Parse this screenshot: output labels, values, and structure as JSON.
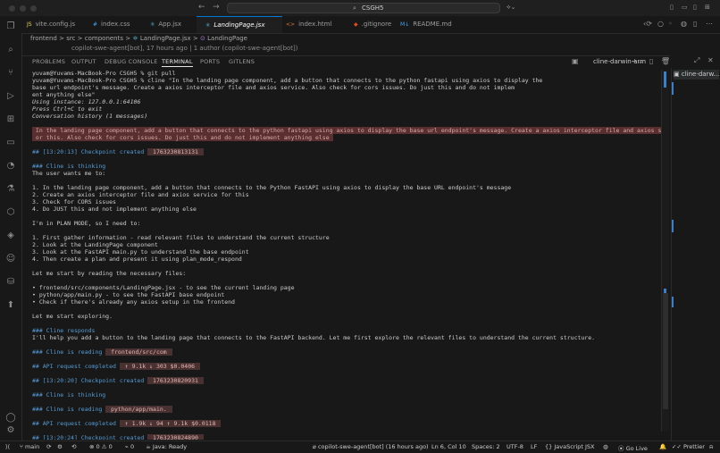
{
  "window": {
    "search_text": "CSGH5"
  },
  "tabs": [
    {
      "label": "vite.config.js",
      "icon": "JS"
    },
    {
      "label": "index.css",
      "icon": "#"
    },
    {
      "label": "App.jsx",
      "icon": "⚛"
    },
    {
      "label": "LandingPage.jsx",
      "icon": "⚛"
    },
    {
      "label": "index.html",
      "icon": "<>"
    },
    {
      "label": ".gitignore",
      "icon": "◆"
    },
    {
      "label": "README.md",
      "icon": "M↓"
    }
  ],
  "breadcrumb": {
    "parts": [
      "frontend",
      "src",
      "components",
      "LandingPage.jsx",
      "LandingPage"
    ],
    "sep": ">"
  },
  "blame": "copilot-swe-agent[bot], 17 hours ago | 1 author (copilot-swe-agent[bot])",
  "panel": {
    "tabs": [
      "PROBLEMS",
      "OUTPUT",
      "DEBUG CONSOLE",
      "TERMINAL",
      "PORTS",
      "GITLENS"
    ],
    "terminal_name": "cline-darwin-arm",
    "right_item": "cline-darw..."
  },
  "terminal": {
    "lines": [
      {
        "t": "yuvam@Yuvams-MacBook-Pro CSGH5 % git pull"
      },
      {
        "t": "yuvam@Yuvams-MacBook-Pro CSGH5 % cline \"In the landing page component, add a button that connects to the python fastapi using axios to display the"
      },
      {
        "t": "base url endpoint's message. Create a axios interceptor file and axios service. Also check for cors issues. Do just this and do not implem"
      },
      {
        "t": "ent anything else\""
      },
      {
        "t": "Using instance: 127.0.0.1:64106",
        "style": "it"
      },
      {
        "t": "Press Ctrl+C to exit",
        "style": "it"
      },
      {
        "t": "Conversation history (1 messages)",
        "style": "it"
      },
      {
        "t": ""
      },
      {
        "t": " In the landing page component, add a button that connects to the python fastapi using axios to display the base url endpoint's message. Create a axios interceptor file and axios service f",
        "style": "hl"
      },
      {
        "t": " or this. Also check for cors issues. Do just this and do not implement anything else ",
        "style": "hl"
      },
      {
        "t": ""
      },
      {
        "t": "## [13:20:13] Checkpoint created ",
        "tag": " 1763230813131 "
      },
      {
        "t": ""
      },
      {
        "t": "### Cline is thinking"
      },
      {
        "t": "The user wants me to:"
      },
      {
        "t": ""
      },
      {
        "t": "1. In the landing page component, add a button that connects to the Python FastAPI using axios to display the base URL endpoint's message"
      },
      {
        "t": "2. Create an axios interceptor file and axios service for this"
      },
      {
        "t": "3. Check for CORS issues"
      },
      {
        "t": "4. Do JUST this and not implement anything else"
      },
      {
        "t": ""
      },
      {
        "t": "I'm in PLAN MODE, so I need to:"
      },
      {
        "t": ""
      },
      {
        "t": "1. First gather information - read relevant files to understand the current structure"
      },
      {
        "t": "2. Look at the LandingPage component"
      },
      {
        "t": "3. Look at the FastAPI main.py to understand the base endpoint"
      },
      {
        "t": "4. Then create a plan and present it using plan_mode_respond"
      },
      {
        "t": ""
      },
      {
        "t": "Let me start by reading the necessary files:"
      },
      {
        "t": ""
      },
      {
        "t": "• frontend/src/components/LandingPage.jsx - to see the current landing page"
      },
      {
        "t": "• python/app/main.py - to see the FastAPI base endpoint"
      },
      {
        "t": "• Check if there's already any axios setup in the frontend"
      },
      {
        "t": ""
      },
      {
        "t": "Let me start exploring."
      },
      {
        "t": ""
      },
      {
        "t": "### Cline responds"
      },
      {
        "t": "I'll help you add a button to the landing page that connects to the FastAPI backend. Let me first explore the relevant files to understand the current structure."
      },
      {
        "t": ""
      },
      {
        "t": "### Cline is reading ",
        "tag": " frontend/src/com "
      },
      {
        "t": ""
      },
      {
        "t": "## API request completed ",
        "tag": " ↑ 9.1k ↓ 303 $0.0406 "
      },
      {
        "t": ""
      },
      {
        "t": "## [13:20:20] Checkpoint created ",
        "tag": " 1763230820931 "
      },
      {
        "t": ""
      },
      {
        "t": "### Cline is thinking"
      },
      {
        "t": ""
      },
      {
        "t": "### Cline is reading ",
        "tag": " python/app/main. "
      },
      {
        "t": ""
      },
      {
        "t": "## API request completed ",
        "tag": " ↑ 1.9k ↓ 94 ↑ 9.1k $0.0118 "
      },
      {
        "t": ""
      },
      {
        "t": "## [13:20:24] Checkpoint created ",
        "tag": " 1763230824890 "
      }
    ]
  },
  "status": {
    "branch": "main",
    "sync": "⟳",
    "errors": "0",
    "warnings": "0",
    "java": "Java: Ready",
    "author": "copilot-swe-agent[bot] (16 hours ago)",
    "position": "Ln 6, Col 10",
    "spaces": "Spaces: 2",
    "encoding": "UTF-8",
    "eol": "LF",
    "language": "JavaScript JSX",
    "golive": "Go Live",
    "prettier": "Prettier"
  },
  "colors": {
    "accent": "#0078d4",
    "highlight_bg": "#5a2f2f",
    "scroll_mark": "#3b7ec9"
  }
}
